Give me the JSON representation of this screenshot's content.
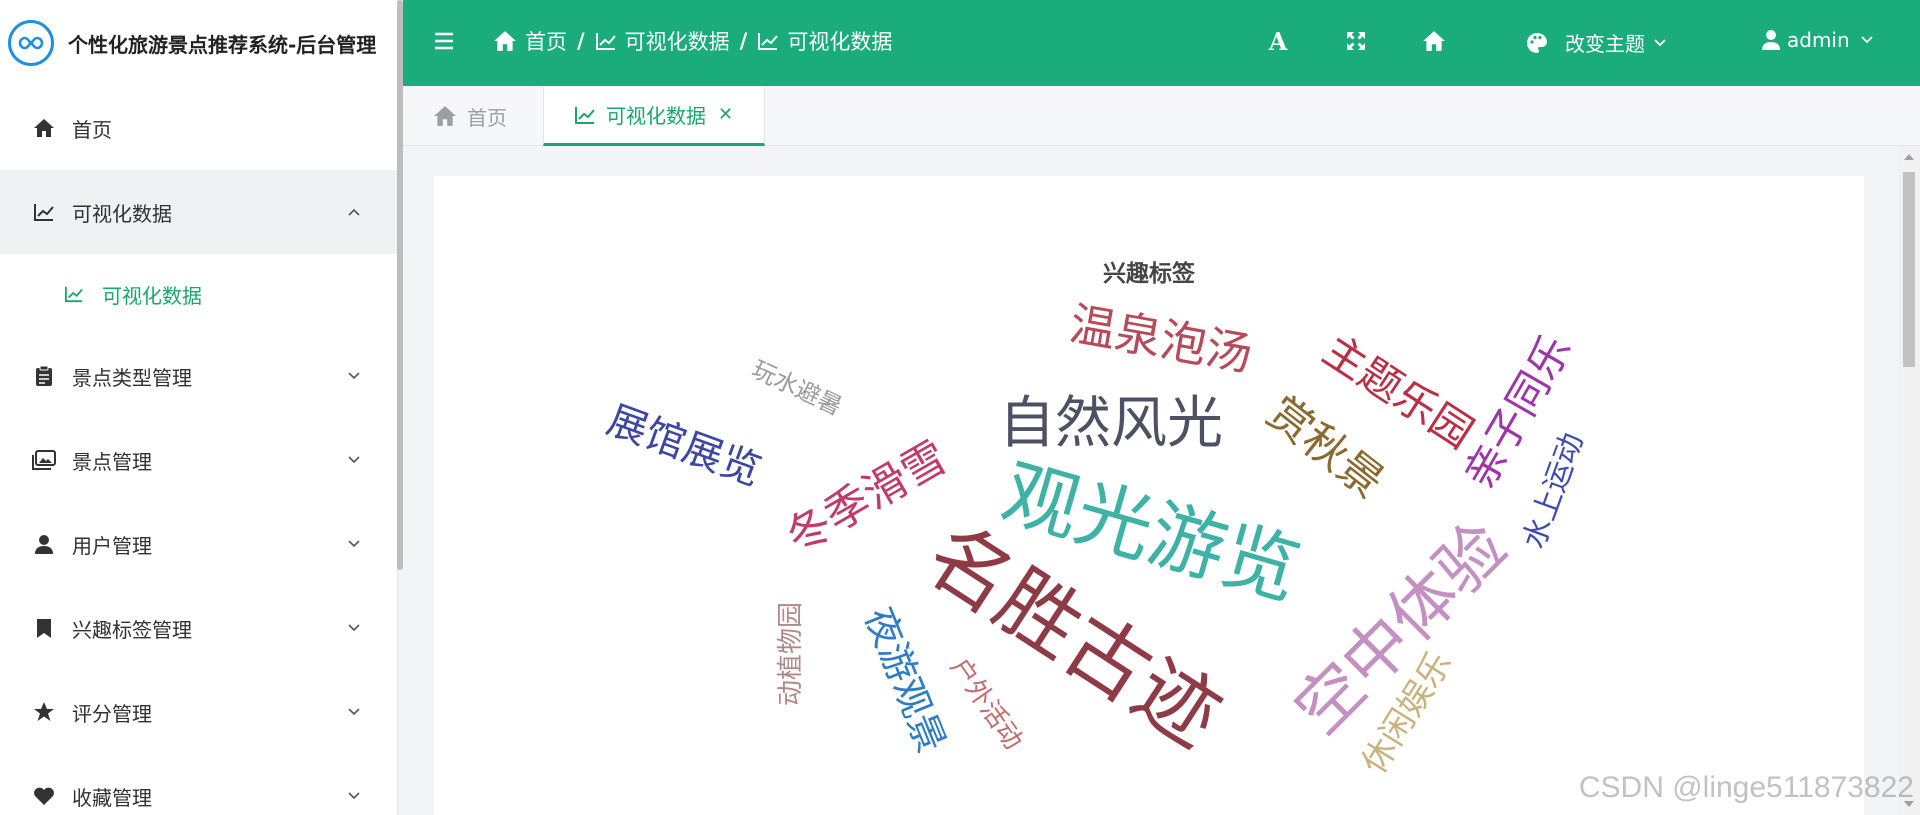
{
  "sidebar": {
    "title": "个性化旅游景点推荐系统-后台管理",
    "items": [
      {
        "label": "首页",
        "icon": "home-icon"
      },
      {
        "label": "可视化数据",
        "icon": "line-chart-icon",
        "open": true,
        "sub": [
          {
            "label": "可视化数据",
            "icon": "line-chart-icon",
            "active": true
          }
        ]
      },
      {
        "label": "景点类型管理",
        "icon": "clipboard-icon"
      },
      {
        "label": "景点管理",
        "icon": "images-icon"
      },
      {
        "label": "用户管理",
        "icon": "user-icon"
      },
      {
        "label": "兴趣标签管理",
        "icon": "bookmark-icon"
      },
      {
        "label": "评分管理",
        "icon": "star-icon"
      },
      {
        "label": "收藏管理",
        "icon": "heart-icon"
      }
    ]
  },
  "header": {
    "breadcrumbs": [
      "首页",
      "可视化数据",
      "可视化数据"
    ],
    "theme_label": "改变主题",
    "user_label": "admin",
    "brand_color": "#1aac7a"
  },
  "tabs": {
    "home_label": "首页",
    "active_label": "可视化数据"
  },
  "chart_data": {
    "type": "wordcloud",
    "title": "兴趣标签",
    "words": [
      {
        "text": "名胜古迹",
        "color": "#8e3b46",
        "weight": 5
      },
      {
        "text": "观光游览",
        "color": "#3fb2a6",
        "weight": 5
      },
      {
        "text": "空中体验",
        "color": "#c48fc1",
        "weight": 4
      },
      {
        "text": "自然风光",
        "color": "#4d5166",
        "weight": 4
      },
      {
        "text": "温泉泡汤",
        "color": "#b74a5a",
        "weight": 3
      },
      {
        "text": "冬季滑雪",
        "color": "#c23a67",
        "weight": 3
      },
      {
        "text": "主题乐园",
        "color": "#bb2f44",
        "weight": 3
      },
      {
        "text": "赏秋景",
        "color": "#8a6a2e",
        "weight": 3
      },
      {
        "text": "亲子同乐",
        "color": "#9c36a8",
        "weight": 3
      },
      {
        "text": "展馆展览",
        "color": "#3d46a2",
        "weight": 3
      },
      {
        "text": "夜游观景",
        "color": "#2f7cc5",
        "weight": 3
      },
      {
        "text": "休闲娱乐",
        "color": "#c9b27f",
        "weight": 2
      },
      {
        "text": "水上运动",
        "color": "#3e4bb3",
        "weight": 2
      },
      {
        "text": "户外活动",
        "color": "#c26d6d",
        "weight": 2
      },
      {
        "text": "动植物园",
        "color": "#b08a86",
        "weight": 2
      },
      {
        "text": "玩水避暑",
        "color": "#9a9aa0",
        "weight": 1
      }
    ]
  },
  "watermark": "CSDN @linge511873822"
}
